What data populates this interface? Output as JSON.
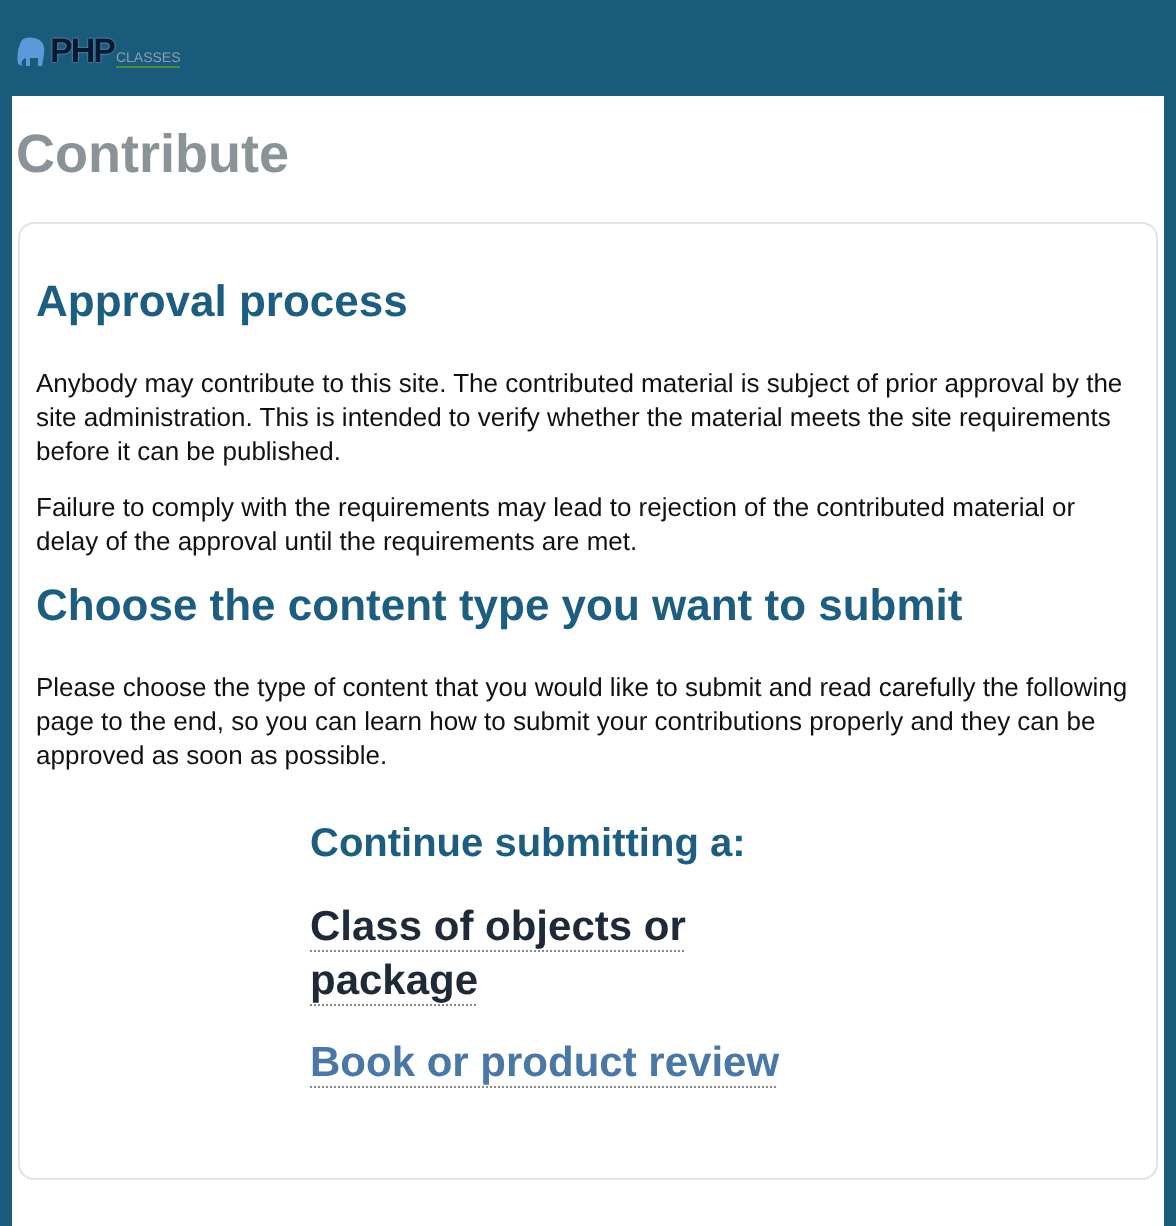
{
  "logo": {
    "primary": "PHP",
    "secondary": "CLASSES"
  },
  "page_title": "Contribute",
  "sections": [
    {
      "heading": "Approval process",
      "paragraphs": [
        "Anybody may contribute to this site. The contributed material is subject of prior approval by the site administration. This is intended to verify whether the material meets the site requirements before it can be published.",
        "Failure to comply with the requirements may lead to rejection of the contributed material or delay of the approval until the requirements are met."
      ]
    },
    {
      "heading": "Choose the content type you want to submit",
      "paragraphs": [
        "Please choose the type of content that you would like to submit and read carefully the following page to the end, so you can learn how to submit your contributions properly and they can be approved as soon as possible."
      ]
    }
  ],
  "continue": {
    "heading": "Continue submitting a:",
    "links": [
      {
        "label": "Class of objects or package",
        "selected": true
      },
      {
        "label": "Book or product review",
        "selected": false
      }
    ]
  }
}
